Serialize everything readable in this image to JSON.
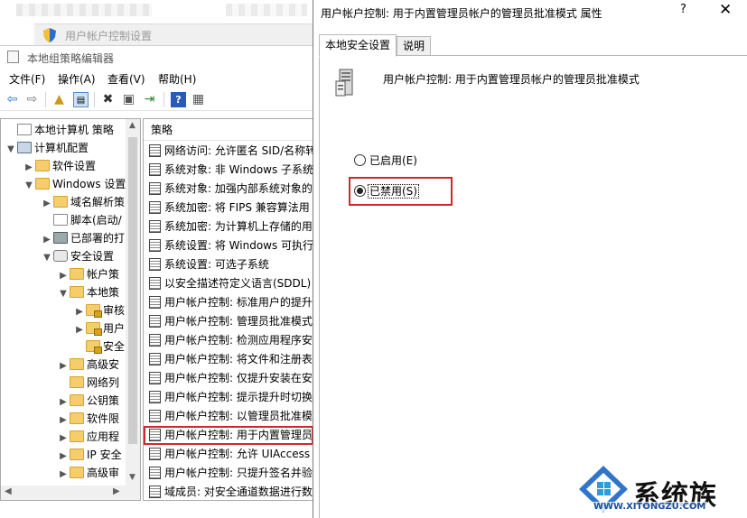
{
  "background_window": {
    "uac_label": "用户帐户控制设置"
  },
  "editor": {
    "title": "本地组策略编辑器",
    "menu": [
      "文件(F)",
      "操作(A)",
      "查看(V)",
      "帮助(H)"
    ],
    "tree": [
      {
        "label": "本地计算机 策略",
        "icon": "doc-icon",
        "arrow": ""
      },
      {
        "label": "计算机配置",
        "icon": "computer-icon",
        "arrow": "▼"
      },
      {
        "label": "软件设置",
        "icon": "folder-icon",
        "arrow": "▶"
      },
      {
        "label": "Windows 设置",
        "icon": "folder-icon",
        "arrow": "▼"
      },
      {
        "label": "域名解析策",
        "icon": "folder-icon",
        "arrow": "▶"
      },
      {
        "label": "脚本(启动/",
        "icon": "script-icon",
        "arrow": ""
      },
      {
        "label": "已部署的打",
        "icon": "printer-icon",
        "arrow": "▶"
      },
      {
        "label": "安全设置",
        "icon": "gear-icon",
        "arrow": "▼"
      },
      {
        "label": "帐户策",
        "icon": "folder-icon",
        "arrow": "▶"
      },
      {
        "label": "本地策",
        "icon": "folder-icon",
        "arrow": "▼"
      },
      {
        "label": "审核",
        "icon": "folder-lock-icon",
        "arrow": "▶"
      },
      {
        "label": "用户",
        "icon": "folder-lock-icon",
        "arrow": "▶"
      },
      {
        "label": "安全",
        "icon": "folder-lock-icon",
        "arrow": ""
      },
      {
        "label": "高级安",
        "icon": "folder-icon",
        "arrow": "▶"
      },
      {
        "label": "网络列",
        "icon": "folder-icon",
        "arrow": ""
      },
      {
        "label": "公钥策",
        "icon": "folder-icon",
        "arrow": "▶"
      },
      {
        "label": "软件限",
        "icon": "folder-icon",
        "arrow": "▶"
      },
      {
        "label": "应用程",
        "icon": "folder-icon",
        "arrow": "▶"
      },
      {
        "label": "IP 安全",
        "icon": "folder-icon",
        "arrow": "▶"
      },
      {
        "label": "高级审",
        "icon": "folder-icon",
        "arrow": "▶"
      }
    ],
    "list_header": "策略",
    "policies": [
      "网络访问: 允许匿名 SID/名称转",
      "系统对象: 非 Windows 子系统",
      "系统对象: 加强内部系统对象的",
      "系统加密: 将 FIPS 兼容算法用",
      "系统加密: 为计算机上存储的用",
      "系统设置: 将 Windows 可执行",
      "系统设置: 可选子系统",
      "以安全描述符定义语言(SDDL)",
      "用户帐户控制: 标准用户的提升",
      "用户帐户控制: 管理员批准模式",
      "用户帐户控制: 检测应用程序安",
      "用户帐户控制: 将文件和注册表",
      "用户帐户控制: 仅提升安装在安",
      "用户帐户控制: 提示提升时切换",
      "用户帐户控制: 以管理员批准模",
      "用户帐户控制: 用于内置管理员",
      "用户帐户控制: 允许 UIAccess",
      "用户帐户控制: 只提升签名并验",
      "域成员: 对安全通道数据进行数"
    ],
    "selected_index": 15
  },
  "dialog": {
    "title": "用户帐户控制: 用于内置管理员帐户的管理员批准模式 属性",
    "help_label": "?",
    "close_label": "✕",
    "tabs": [
      "本地安全设置",
      "说明"
    ],
    "policy_name": "用户帐户控制: 用于内置管理员帐户的管理员批准模式",
    "options": [
      {
        "label": "已启用(E)",
        "checked": false
      },
      {
        "label": "已禁用(S)",
        "checked": true
      }
    ],
    "highlight_color": "#d0272f"
  },
  "watermark": {
    "name": "系统族",
    "url": "WWW.XITONGZU.COM"
  }
}
